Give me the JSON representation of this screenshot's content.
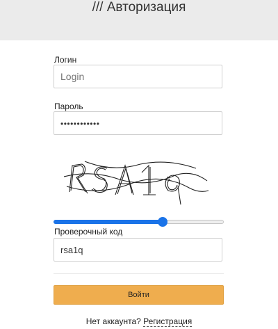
{
  "header": {
    "title": "/// Авторизация"
  },
  "form": {
    "login_label": "Логин",
    "login_placeholder": "Login",
    "login_value": "",
    "password_label": "Пароль",
    "password_value": "••••••••••••",
    "captcha_text": "RSA1q",
    "slider_level": 0.64,
    "verify_label": "Проверочный код",
    "verify_value": "rsa1q",
    "submit_label": "Войти"
  },
  "footer": {
    "prompt": "Нет аккаунта?",
    "register_link": "Регистрация"
  },
  "colors": {
    "accent": "#1a73e8",
    "button": "#efad4e",
    "header_bg": "#ebebeb"
  }
}
